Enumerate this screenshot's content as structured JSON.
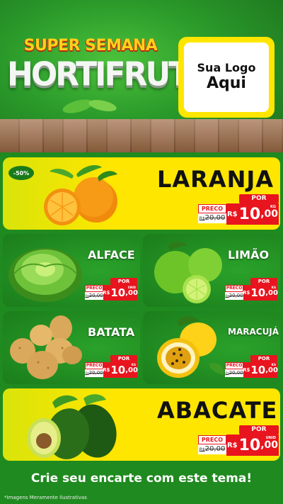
{
  "header": {
    "super_line": "SUPER SEMANA",
    "main_line": "HORTIFRUTI",
    "logo_line1": "Sua Logo",
    "logo_line2": "Aqui"
  },
  "products": [
    {
      "name": "LARANJA",
      "badge": "-50%",
      "label": "PRECO",
      "por": "POR",
      "old_prefix": "R$",
      "old_price": "20,00",
      "new_prefix": "R$",
      "new_int": "10",
      "new_dec": ",00",
      "unit": "KG"
    },
    {
      "name": "ALFACE",
      "label": "PRECO",
      "por": "POR",
      "old_prefix": "R$",
      "old_price": "20,00",
      "new_prefix": "R$",
      "new_int": "10",
      "new_dec": ",00",
      "unit": "UNID"
    },
    {
      "name": "LIMÃO",
      "label": "PRECO",
      "por": "POR",
      "old_prefix": "R$",
      "old_price": "20,00",
      "new_prefix": "R$",
      "new_int": "10",
      "new_dec": ",00",
      "unit": "KG"
    },
    {
      "name": "BATATA",
      "label": "PRECO",
      "por": "POR",
      "old_prefix": "R$",
      "old_price": "20,00",
      "new_prefix": "R$",
      "new_int": "10",
      "new_dec": ",00",
      "unit": "KG"
    },
    {
      "name": "MARACUJÁ",
      "label": "PRECO",
      "por": "POR",
      "old_prefix": "R$",
      "old_price": "20,00",
      "new_prefix": "R$",
      "new_int": "10",
      "new_dec": ",00",
      "unit": "KG"
    },
    {
      "name": "ABACATE",
      "label": "PRECO",
      "por": "POR",
      "old_prefix": "R$",
      "old_price": "20,00",
      "new_prefix": "R$",
      "new_int": "10",
      "new_dec": ",00",
      "unit": "UNID"
    }
  ],
  "footer": {
    "cta": "Crie seu encarte com este tema!",
    "disclaimer": "*Imagens Meramente Ilustrativas"
  },
  "colors": {
    "yellow": "#ffe600",
    "green": "#1f8a1f",
    "red": "#e8141e"
  }
}
